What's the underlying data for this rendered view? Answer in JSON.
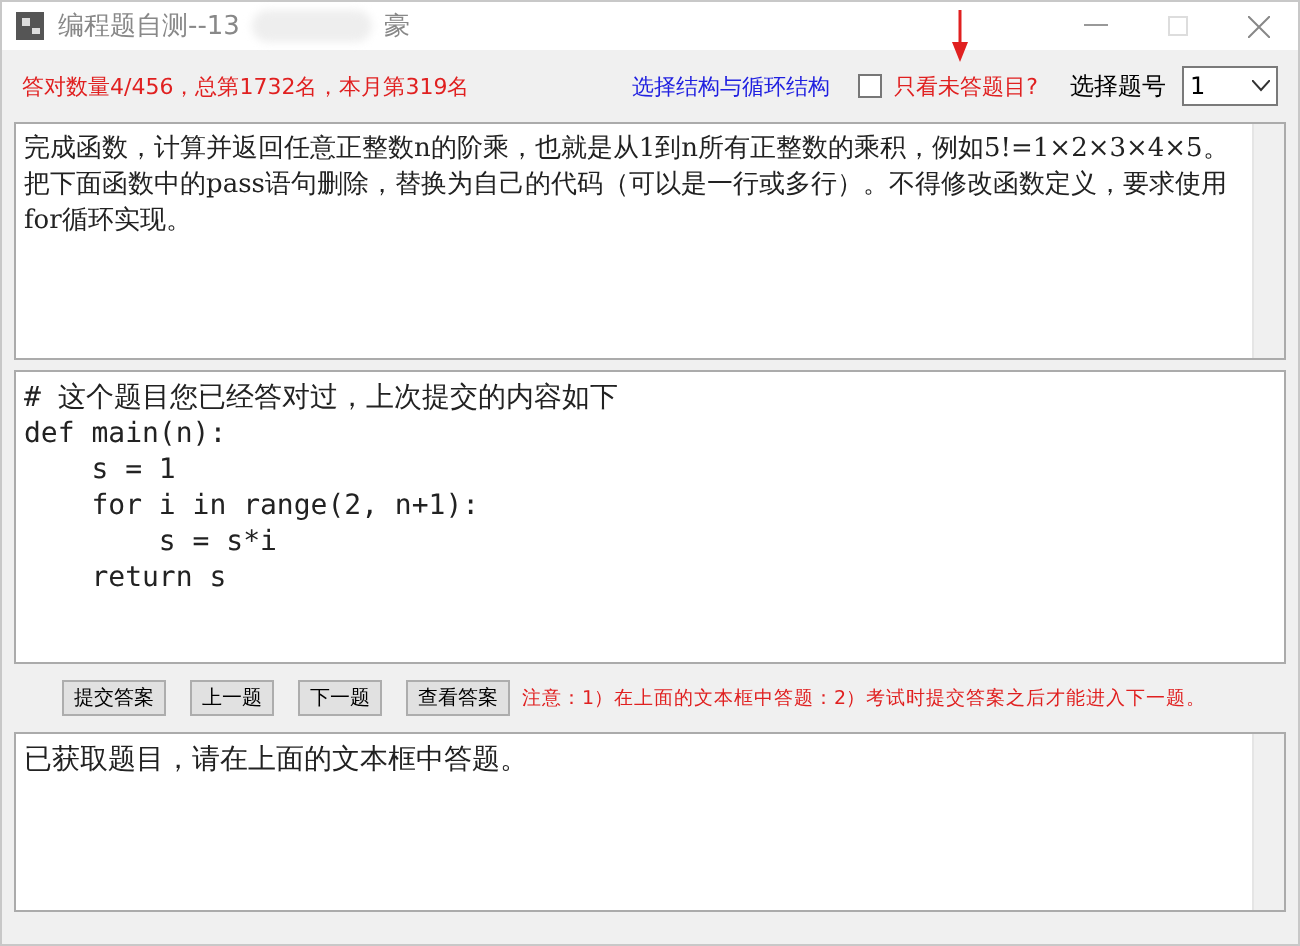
{
  "window": {
    "title_start": "编程题自测--13",
    "title_end": "豪"
  },
  "toolbar": {
    "score": "答对数量4/456，总第1732名，本月第319名",
    "category_link": "选择结构与循环结构",
    "unanswered_only": {
      "label": "只看未答题目?",
      "checked": false
    },
    "question_label": "选择题号",
    "question_select": {
      "value": "1"
    }
  },
  "question_text": "完成函数，计算并返回任意正整数n的阶乘，也就是从1到n所有正整数的乘积，例如5!=1×2×3×4×5。把下面函数中的pass语句删除，替换为自己的代码（可以是一行或多行）。不得修改函数定义，要求使用for循环实现。",
  "code_lines": [
    "# 这个题目您已经答对过，上次提交的内容如下",
    "def main(n):",
    "    s = 1",
    "    for i in range(2, n+1):",
    "        s = s*i",
    "    return s"
  ],
  "buttons": [
    "提交答案",
    "上一题",
    "下一题",
    "查看答案"
  ],
  "notice": "注意：1）在上面的文本框中答题：2）考试时提交答案之后才能进入下一题。",
  "status_text": "已获取题目，请在上面的文本框中答题。"
}
